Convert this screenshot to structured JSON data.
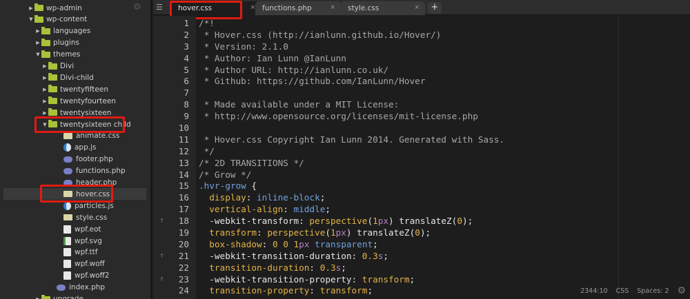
{
  "sidebar": {
    "items": [
      {
        "label": "wp-admin",
        "level": 0,
        "type": "folder",
        "open": false
      },
      {
        "label": "wp-content",
        "level": 0,
        "type": "folder",
        "open": true
      },
      {
        "label": "languages",
        "level": 1,
        "type": "folder",
        "open": false
      },
      {
        "label": "plugins",
        "level": 1,
        "type": "folder",
        "open": false
      },
      {
        "label": "themes",
        "level": 1,
        "type": "folder",
        "open": true
      },
      {
        "label": "Divi",
        "level": 2,
        "type": "folder",
        "open": false
      },
      {
        "label": "Divi-child",
        "level": 2,
        "type": "folder",
        "open": false
      },
      {
        "label": "twentyfifteen",
        "level": 2,
        "type": "folder",
        "open": false
      },
      {
        "label": "twentyfourteen",
        "level": 2,
        "type": "folder",
        "open": false
      },
      {
        "label": "twentysixteen",
        "level": 2,
        "type": "folder",
        "open": false
      },
      {
        "label": "twentysixteen child",
        "level": 2,
        "type": "folder",
        "open": true
      },
      {
        "label": "animate.css",
        "level": 3,
        "type": "css"
      },
      {
        "label": "app.js",
        "level": 3,
        "type": "js"
      },
      {
        "label": "footer.php",
        "level": 3,
        "type": "php"
      },
      {
        "label": "functions.php",
        "level": 3,
        "type": "php"
      },
      {
        "label": "header.php",
        "level": 3,
        "type": "php"
      },
      {
        "label": "hover.css",
        "level": 3,
        "type": "css",
        "selected": true
      },
      {
        "label": "particles.js",
        "level": 3,
        "type": "js"
      },
      {
        "label": "style.css",
        "level": 3,
        "type": "css"
      },
      {
        "label": "wpf.eot",
        "level": 3,
        "type": "doc"
      },
      {
        "label": "wpf.svg",
        "level": 3,
        "type": "svg"
      },
      {
        "label": "wpf.ttf",
        "level": 3,
        "type": "doc"
      },
      {
        "label": "wpf.woff",
        "level": 3,
        "type": "doc"
      },
      {
        "label": "wpf.woff2",
        "level": 3,
        "type": "doc"
      },
      {
        "label": "index.php",
        "level": 2,
        "type": "php"
      },
      {
        "label": "upgrade",
        "level": 1,
        "type": "folder",
        "open": false
      }
    ]
  },
  "tabs": [
    {
      "label": "hover.css",
      "active": true
    },
    {
      "label": "functions.php"
    },
    {
      "label": "style.css"
    }
  ],
  "tab_close": "×",
  "new_tab": "+",
  "code": [
    [
      [
        "c",
        "/*!"
      ]
    ],
    [
      [
        "c",
        " * Hover.css (http://ianlunn.github.io/Hover/)"
      ]
    ],
    [
      [
        "c",
        " * Version: 2.1.0"
      ]
    ],
    [
      [
        "c",
        " * Author: Ian Lunn @IanLunn"
      ]
    ],
    [
      [
        "c",
        " * Author URL: http://ianlunn.co.uk/"
      ]
    ],
    [
      [
        "c",
        " * Github: https://github.com/IanLunn/Hover"
      ]
    ],
    [],
    [
      [
        "c",
        " * Made available under a MIT License:"
      ]
    ],
    [
      [
        "c",
        " * http://www.opensource.org/licenses/mit-license.php"
      ]
    ],
    [],
    [
      [
        "c",
        " * Hover.css Copyright Ian Lunn 2014. Generated with Sass."
      ]
    ],
    [
      [
        "c",
        " */"
      ]
    ],
    [
      [
        "c",
        "/* 2D TRANSITIONS */"
      ]
    ],
    [
      [
        "c",
        "/* Grow */"
      ]
    ],
    [
      [
        "s",
        ".hvr-grow"
      ],
      [
        "t",
        " {"
      ]
    ],
    [
      [
        "t",
        "  "
      ],
      [
        "p",
        "display"
      ],
      [
        "t",
        ": "
      ],
      [
        "v",
        "inline-block"
      ],
      [
        "t",
        ";"
      ]
    ],
    [
      [
        "t",
        "  "
      ],
      [
        "p",
        "vertical-align"
      ],
      [
        "t",
        ": "
      ],
      [
        "v",
        "middle"
      ],
      [
        "t",
        ";"
      ]
    ],
    [
      [
        "t",
        "  -webkit-transform: "
      ],
      [
        "f",
        "perspective"
      ],
      [
        "t",
        "("
      ],
      [
        "n",
        "1"
      ],
      [
        "u",
        "px"
      ],
      [
        "t",
        ") translateZ("
      ],
      [
        "n",
        "0"
      ],
      [
        "t",
        ");"
      ]
    ],
    [
      [
        "t",
        "  "
      ],
      [
        "p",
        "transform"
      ],
      [
        "t",
        ": "
      ],
      [
        "f",
        "perspective"
      ],
      [
        "t",
        "("
      ],
      [
        "n",
        "1"
      ],
      [
        "u",
        "px"
      ],
      [
        "t",
        ") translateZ("
      ],
      [
        "n",
        "0"
      ],
      [
        "t",
        ");"
      ]
    ],
    [
      [
        "t",
        "  "
      ],
      [
        "p",
        "box-shadow"
      ],
      [
        "t",
        ": "
      ],
      [
        "n",
        "0 0 1"
      ],
      [
        "u",
        "px"
      ],
      [
        "t",
        " "
      ],
      [
        "v",
        "transparent"
      ],
      [
        "t",
        ";"
      ]
    ],
    [
      [
        "t",
        "  -webkit-transition-duration: "
      ],
      [
        "n",
        "0.3"
      ],
      [
        "u",
        "s"
      ],
      [
        "t",
        ";"
      ]
    ],
    [
      [
        "t",
        "  "
      ],
      [
        "p",
        "transition-duration"
      ],
      [
        "t",
        ": "
      ],
      [
        "n",
        "0.3"
      ],
      [
        "u",
        "s"
      ],
      [
        "t",
        ";"
      ]
    ],
    [
      [
        "t",
        "  -webkit-transition-property: "
      ],
      [
        "p",
        "transform"
      ],
      [
        "t",
        ";"
      ]
    ],
    [
      [
        "t",
        "  "
      ],
      [
        "p",
        "transition-property"
      ],
      [
        "t",
        ": "
      ],
      [
        "p",
        "transform"
      ],
      [
        "t",
        ";"
      ]
    ]
  ],
  "fold_lines": [
    18,
    21,
    23
  ],
  "fold_marker": "f",
  "status": {
    "cursor": "2344:10",
    "mode": "CSS",
    "indent": "Spaces: 2"
  },
  "colors": {
    "highlight": "#e01b12",
    "folder": "#a8c23a",
    "property": "#e3b348",
    "value": "#6fa3df",
    "unit": "#b882c7"
  }
}
